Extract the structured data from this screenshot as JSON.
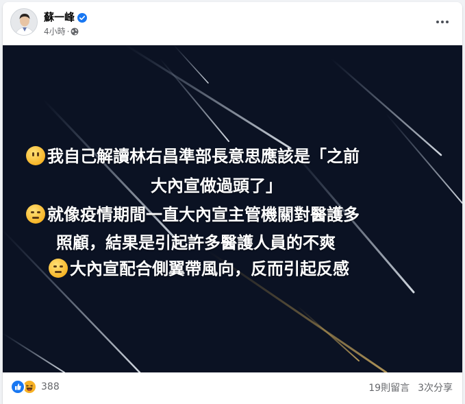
{
  "post": {
    "author": "蘇一峰",
    "time": "4小時",
    "separator": "·",
    "verified_icon": "verified-badge-icon",
    "privacy_icon": "globe-icon"
  },
  "image_text": {
    "lines": [
      {
        "emoji": "no-mouth-face-emoji",
        "text": "我自己解讀林右昌準部長意思應該是「之前"
      },
      {
        "emoji": null,
        "text": "大內宣做過頭了」"
      },
      {
        "emoji": "expressionless-face-emoji",
        "text": "就像疫情期間一直大內宣主管機關對醫護多"
      },
      {
        "emoji": null,
        "text": "照顧，結果是引起許多醫護人員的不爽"
      },
      {
        "emoji": "expressionless-face-emoji",
        "text": "大內宣配合側翼帶風向，反而引起反感"
      }
    ]
  },
  "footer": {
    "reaction_icons": [
      "like-icon",
      "haha-icon"
    ],
    "reaction_count": "388",
    "comments": "19則留言",
    "shares": "3次分享"
  },
  "colors": {
    "image_bg": "#0b1223",
    "brand_blue": "#1877f2",
    "secondary_text": "#65676b"
  }
}
